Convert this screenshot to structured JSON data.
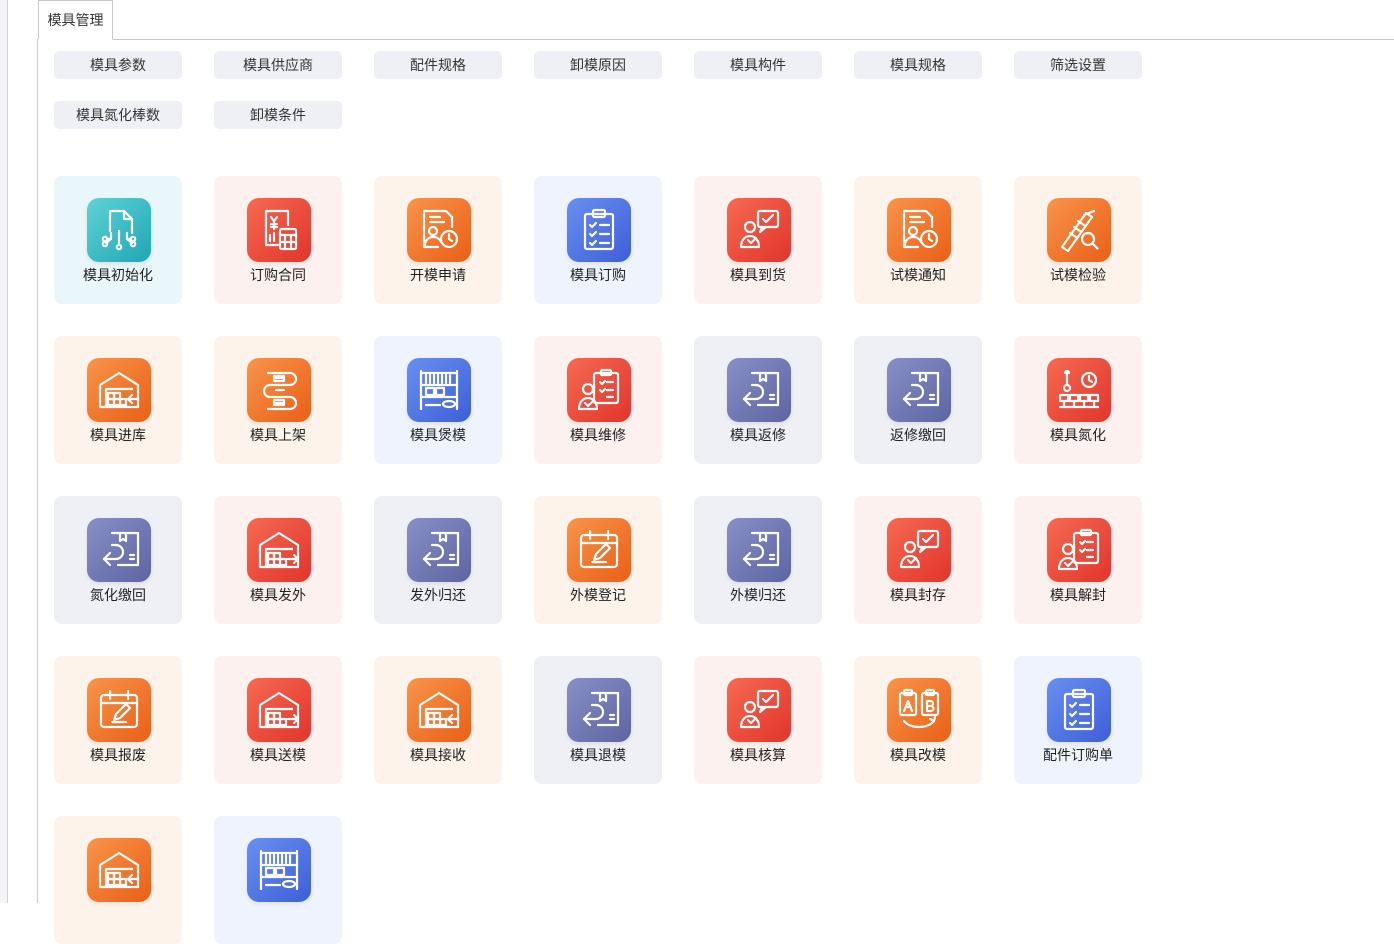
{
  "tab": {
    "label": "模具管理"
  },
  "top_buttons": [
    "模具参数",
    "模具供应商",
    "配件规格",
    "卸模原因",
    "模具构件",
    "模具规格",
    "筛选设置",
    "模具氮化棒数",
    "卸模条件"
  ],
  "tiles": [
    {
      "label": "模具初始化",
      "icon": "chip-document-icon",
      "color": "teal"
    },
    {
      "label": "订购合同",
      "icon": "invoice-calculator-icon",
      "color": "red"
    },
    {
      "label": "开模申请",
      "icon": "user-document-clock-icon",
      "color": "orange"
    },
    {
      "label": "模具订购",
      "icon": "clipboard-checklist-icon",
      "color": "blue"
    },
    {
      "label": "模具到货",
      "icon": "person-check-message-icon",
      "color": "red"
    },
    {
      "label": "试模通知",
      "icon": "user-document-clock-icon",
      "color": "orange"
    },
    {
      "label": "试模检验",
      "icon": "caliper-search-icon",
      "color": "orange"
    },
    {
      "label": "模具进库",
      "icon": "warehouse-in-icon",
      "color": "orange"
    },
    {
      "label": "模具上架",
      "icon": "conveyor-path-icon",
      "color": "orange"
    },
    {
      "label": "模具煲模",
      "icon": "shelf-rack-icon",
      "color": "blue"
    },
    {
      "label": "模具维修",
      "icon": "person-clipboard-icon",
      "color": "red"
    },
    {
      "label": "模具返修",
      "icon": "box-return-icon",
      "color": "slate"
    },
    {
      "label": "返修缴回",
      "icon": "box-return-icon",
      "color": "slate"
    },
    {
      "label": "模具氮化",
      "icon": "thermometer-grid-icon",
      "color": "red"
    },
    {
      "label": "氮化缴回",
      "icon": "box-return-icon",
      "color": "slate"
    },
    {
      "label": "模具发外",
      "icon": "warehouse-out-icon",
      "color": "red"
    },
    {
      "label": "发外归还",
      "icon": "box-return-icon",
      "color": "slate"
    },
    {
      "label": "外模登记",
      "icon": "calendar-edit-icon",
      "color": "orange"
    },
    {
      "label": "外模归还",
      "icon": "box-return-icon",
      "color": "slate"
    },
    {
      "label": "模具封存",
      "icon": "person-check-message-icon",
      "color": "red"
    },
    {
      "label": "模具解封",
      "icon": "person-clipboard-icon",
      "color": "red"
    },
    {
      "label": "模具报废",
      "icon": "calendar-edit-icon",
      "color": "orange"
    },
    {
      "label": "模具送模",
      "icon": "warehouse-out-icon",
      "color": "red"
    },
    {
      "label": "模具接收",
      "icon": "warehouse-in-icon",
      "color": "orange"
    },
    {
      "label": "模具退模",
      "icon": "box-return-icon",
      "color": "slate"
    },
    {
      "label": "模具核算",
      "icon": "person-check-message-icon",
      "color": "red"
    },
    {
      "label": "模具改模",
      "icon": "ab-exchange-icon",
      "color": "orange"
    },
    {
      "label": "配件订购单",
      "icon": "clipboard-checklist-icon",
      "color": "blue"
    },
    {
      "label": "",
      "icon": "warehouse-in-icon",
      "color": "orange"
    },
    {
      "label": "",
      "icon": "shelf-rack-icon",
      "color": "blue"
    }
  ]
}
